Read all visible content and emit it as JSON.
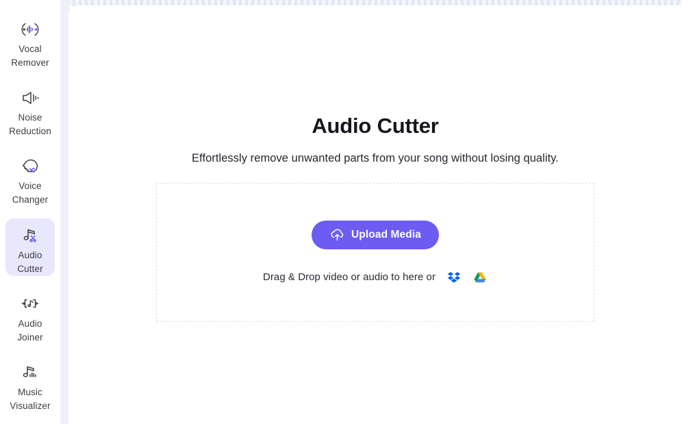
{
  "sidebar": {
    "items": [
      {
        "label": "Vocal\nRemover",
        "icon": "vocal-remover-icon",
        "active": false
      },
      {
        "label": "Noise\nReduction",
        "icon": "noise-reduction-icon",
        "active": false
      },
      {
        "label": "Voice\nChanger",
        "icon": "voice-changer-icon",
        "active": false
      },
      {
        "label": "Audio\nCutter",
        "icon": "audio-cutter-icon",
        "active": true
      },
      {
        "label": "Audio\nJoiner",
        "icon": "audio-joiner-icon",
        "active": false
      },
      {
        "label": "Music\nVisualizer",
        "icon": "music-visualizer-icon",
        "active": false
      }
    ]
  },
  "main": {
    "title": "Audio Cutter",
    "subtitle": "Effortlessly remove unwanted parts from your song without losing quality.",
    "dropzone": {
      "upload_button_label": "Upload Media",
      "upload_button_icon": "cloud-upload-icon",
      "drag_text": "Drag & Drop video or audio to here or",
      "cloud_sources": [
        {
          "name": "dropbox-icon",
          "label": "Dropbox"
        },
        {
          "name": "google-drive-icon",
          "label": "Google Drive"
        }
      ]
    }
  },
  "colors": {
    "accent": "#6c5cf2",
    "active_nav_bg": "#e9e7fb",
    "gutter": "#eff1fa",
    "dropzone_border": "#e2e2e8",
    "dropbox_blue": "#0061fe",
    "gdrive_blue": "#4285f4",
    "gdrive_green": "#0f9d58",
    "gdrive_yellow": "#f4b400"
  }
}
